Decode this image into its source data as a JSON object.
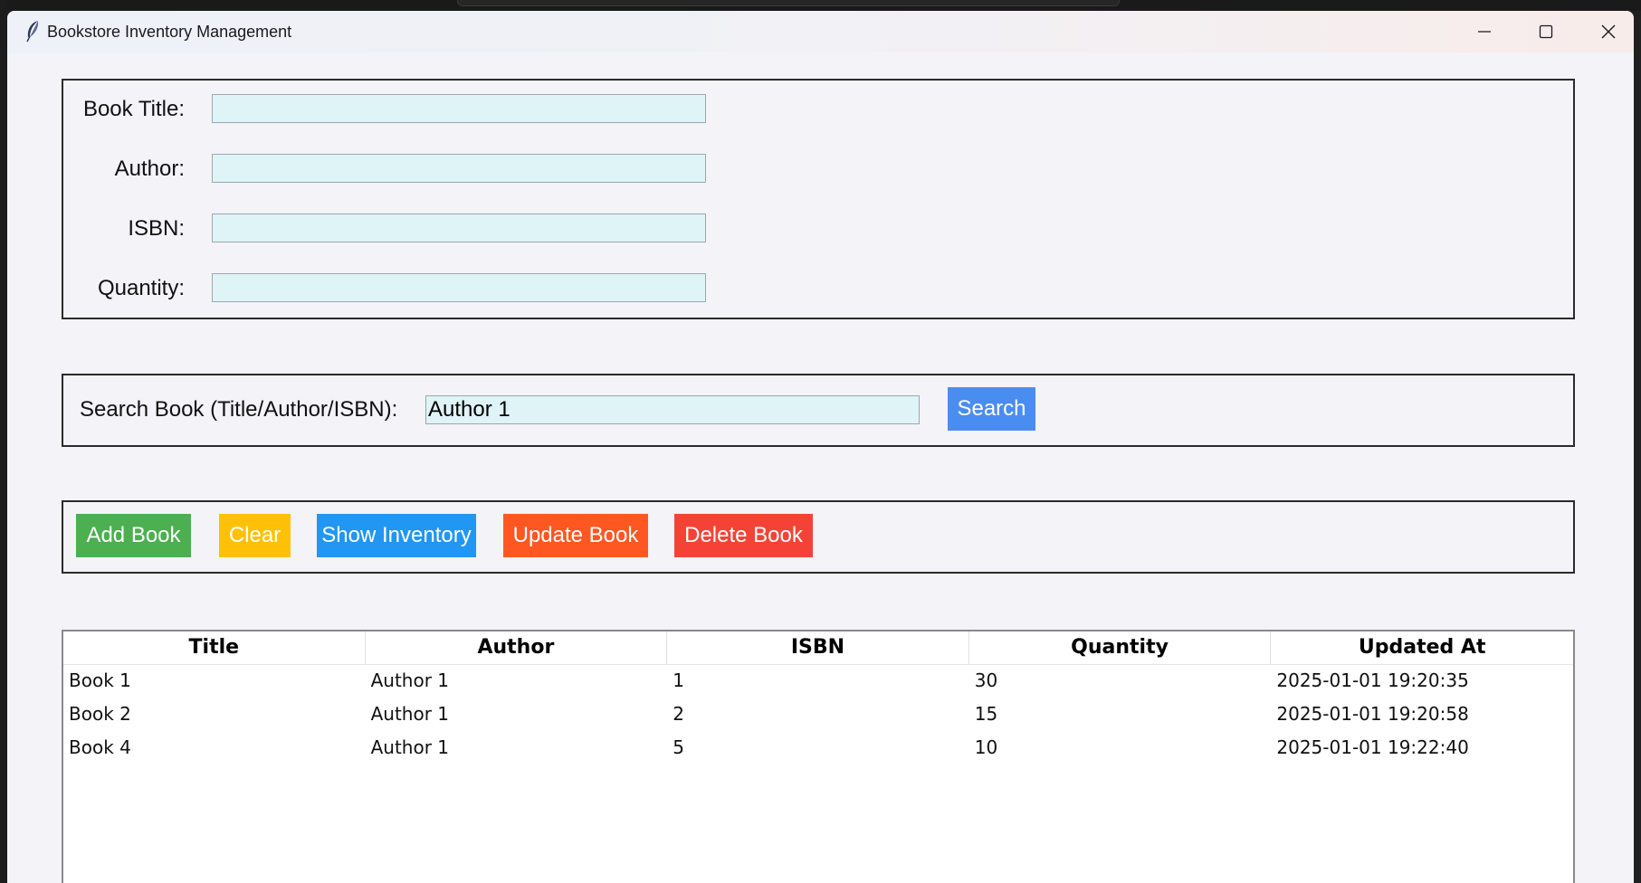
{
  "window": {
    "title": "Bookstore Inventory Management"
  },
  "form": {
    "title_label": "Book Title:",
    "author_label": "Author:",
    "isbn_label": "ISBN:",
    "quantity_label": "Quantity:",
    "title_value": "",
    "author_value": "",
    "isbn_value": "",
    "quantity_value": ""
  },
  "search": {
    "label": "Search Book (Title/Author/ISBN):",
    "value": "Author 1",
    "button_label": "Search"
  },
  "actions": {
    "add": "Add Book",
    "clear": "Clear",
    "show": "Show Inventory",
    "update": "Update Book",
    "delete": "Delete Book"
  },
  "table": {
    "columns": [
      "Title",
      "Author",
      "ISBN",
      "Quantity",
      "Updated At"
    ],
    "rows": [
      [
        "Book 1",
        "Author 1",
        "1",
        "30",
        "2025-01-01 19:20:35"
      ],
      [
        "Book 2",
        "Author 1",
        "2",
        "15",
        "2025-01-01 19:20:58"
      ],
      [
        "Book 4",
        "Author 1",
        "5",
        "10",
        "2025-01-01 19:22:40"
      ]
    ]
  },
  "colors": {
    "add": "#4caf50",
    "clear": "#ffc107",
    "show": "#2196f3",
    "update": "#ff5722",
    "delete": "#f44336",
    "search": "#4a8df0",
    "entry_bg": "#dff4f6"
  },
  "icons": {
    "app": "feather-icon",
    "minimize": "minimize-icon",
    "maximize": "maximize-icon",
    "close": "close-icon"
  }
}
